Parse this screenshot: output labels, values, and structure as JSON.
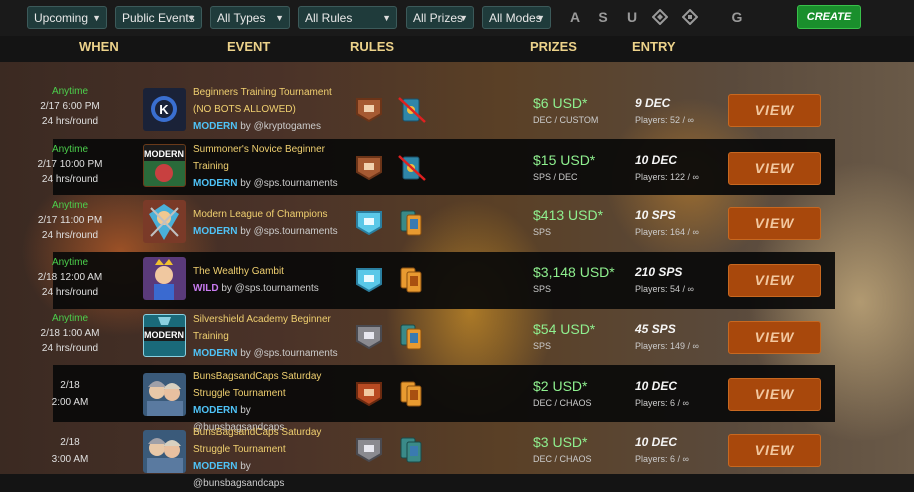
{
  "filters": {
    "status": "Upcoming",
    "events": "Public Events",
    "types": "All Types",
    "rules": "All Rules",
    "prizes": "All Prizes",
    "modes": "All Modes"
  },
  "game_icons": [
    "A",
    "S",
    "U",
    "K",
    "E",
    "G"
  ],
  "create_label": "CREATE",
  "columns": [
    "WHEN",
    "EVENT",
    "RULES",
    "PRIZES",
    "ENTRY"
  ],
  "rows": [
    {
      "when1": "Anytime",
      "when2": "2/17 6:00 PM",
      "when3": "24 hrs/round",
      "title": "Beginners Training Tournament (NO BOTS ALLOWED)",
      "format": "MODERN",
      "by": "by @kryptogames",
      "prize": "$6 USD*",
      "prize_sub": "DEC / CUSTOM",
      "entry": "9 DEC",
      "players": "Players: 52 / ∞",
      "view": "VIEW"
    },
    {
      "when1": "Anytime",
      "when2": "2/17 10:00 PM",
      "when3": "24 hrs/round",
      "title": "Summoner's Novice Beginner Training",
      "format": "MODERN",
      "by": "by @sps.tournaments",
      "prize": "$15 USD*",
      "prize_sub": "SPS / DEC",
      "entry": "10 DEC",
      "players": "Players: 122 / ∞",
      "view": "VIEW"
    },
    {
      "when1": "Anytime",
      "when2": "2/17 11:00 PM",
      "when3": "24 hrs/round",
      "title": "Modern League of Champions",
      "format": "MODERN",
      "by": "by @sps.tournaments",
      "prize": "$413 USD*",
      "prize_sub": "SPS",
      "entry": "10 SPS",
      "players": "Players: 164 / ∞",
      "view": "VIEW"
    },
    {
      "when1": "Anytime",
      "when2": "2/18 12:00 AM",
      "when3": "24 hrs/round",
      "title": "The Wealthy Gambit",
      "format": "WILD",
      "by": "by @sps.tournaments",
      "prize": "$3,148 USD*",
      "prize_sub": "SPS",
      "entry": "210 SPS",
      "players": "Players: 54 / ∞",
      "view": "VIEW"
    },
    {
      "when1": "Anytime",
      "when2": "2/18 1:00 AM",
      "when3": "24 hrs/round",
      "title": "Silvershield Academy Beginner Training",
      "format": "MODERN",
      "by": "by @sps.tournaments",
      "prize": "$54 USD*",
      "prize_sub": "SPS",
      "entry": "45 SPS",
      "players": "Players: 149 / ∞",
      "view": "VIEW"
    },
    {
      "when1": "",
      "when2": "2/18",
      "when3": "2:00 AM",
      "title": "BunsBagsandCaps Saturday Struggle Tournament",
      "format": "MODERN",
      "by": "by @bunsbagsandcaps",
      "prize": "$2 USD*",
      "prize_sub": "DEC / CHAOS",
      "entry": "10 DEC",
      "players": "Players: 6 / ∞",
      "view": "VIEW"
    },
    {
      "when1": "",
      "when2": "2/18",
      "when3": "3:00 AM",
      "title": "BunsBagsandCaps Saturday Struggle Tournament",
      "format": "MODERN",
      "by": "by @bunsbagsandcaps",
      "prize": "$3 USD*",
      "prize_sub": "DEC / CHAOS",
      "entry": "10 DEC",
      "players": "Players: 6 / ∞",
      "view": "VIEW"
    }
  ],
  "thumb_labels": [
    "",
    "MODERN",
    "",
    "",
    "MODERN",
    "",
    ""
  ],
  "icon_names": {
    "league_bronze": "bronze-league-icon",
    "league_diamond": "diamond-league-icon",
    "league_silver": "silver-league-icon",
    "no_cards": "no-cards-icon",
    "cards": "cards-icon"
  }
}
